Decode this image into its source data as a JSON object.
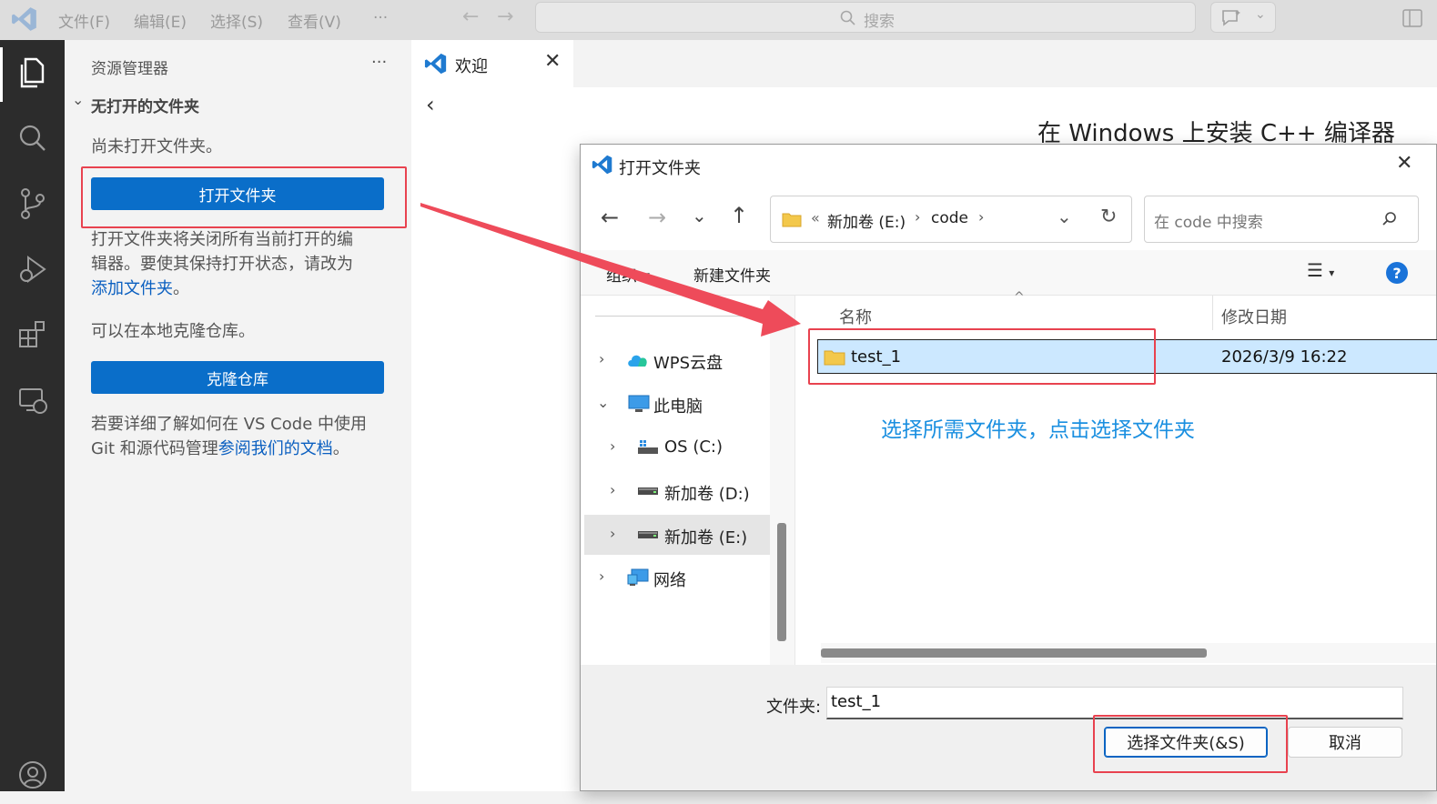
{
  "titlebar": {
    "menu": [
      "文件(F)",
      "编辑(E)",
      "选择(S)",
      "查看(V)",
      "···"
    ],
    "search_placeholder": "搜索"
  },
  "sidebar": {
    "title": "资源管理器",
    "more": "···",
    "section": "无打开的文件夹",
    "no_folder_text": "尚未打开文件夹。",
    "open_folder_button": "打开文件夹",
    "info_line1": "打开文件夹将关闭所有当前打开的编",
    "info_line2": "辑器。要使其保持打开状态，请改为",
    "add_folder_link": "添加文件夹",
    "period": "。",
    "clone_hint": "可以在本地克隆仓库。",
    "clone_button": "克隆仓库",
    "git_line1": "若要详细了解如何在 VS Code 中使用",
    "git_line2_prefix": "Git 和源代码管理",
    "docs_link": "参阅我们的文档",
    "git_line2_suffix": "。"
  },
  "editor": {
    "tab_label": "欢迎",
    "walkthrough_title": "在 Windows 上安装 C++ 编译器"
  },
  "dialog": {
    "title": "打开文件夹",
    "breadcrumb": [
      "«",
      "新加卷 (E:)",
      "code"
    ],
    "search_placeholder": "在 code 中搜索",
    "organize": "组织",
    "new_folder": "新建文件夹",
    "nav": [
      {
        "label": "WPS云盘",
        "icon": "cloud-icon"
      },
      {
        "label": "此电脑",
        "icon": "computer-icon"
      },
      {
        "label": "OS (C:)",
        "icon": "os-drive-icon"
      },
      {
        "label": "新加卷 (D:)",
        "icon": "drive-icon"
      },
      {
        "label": "新加卷 (E:)",
        "icon": "drive-icon"
      },
      {
        "label": "网络",
        "icon": "network-icon"
      }
    ],
    "columns": {
      "name": "名称",
      "modified": "修改日期"
    },
    "files": [
      {
        "name": "test_1",
        "modified": "2026/3/9 16:22"
      }
    ],
    "annotation": "选择所需文件夹，点击选择文件夹",
    "folder_label": "文件夹:",
    "folder_value": "test_1",
    "select_button": "选择文件夹(&S)",
    "cancel_button": "取消"
  },
  "colors": {
    "accent": "#0a6ec9",
    "annotation": "#1a8fe0",
    "highlight_red": "#e8424f",
    "selected_row": "#cce8ff"
  }
}
